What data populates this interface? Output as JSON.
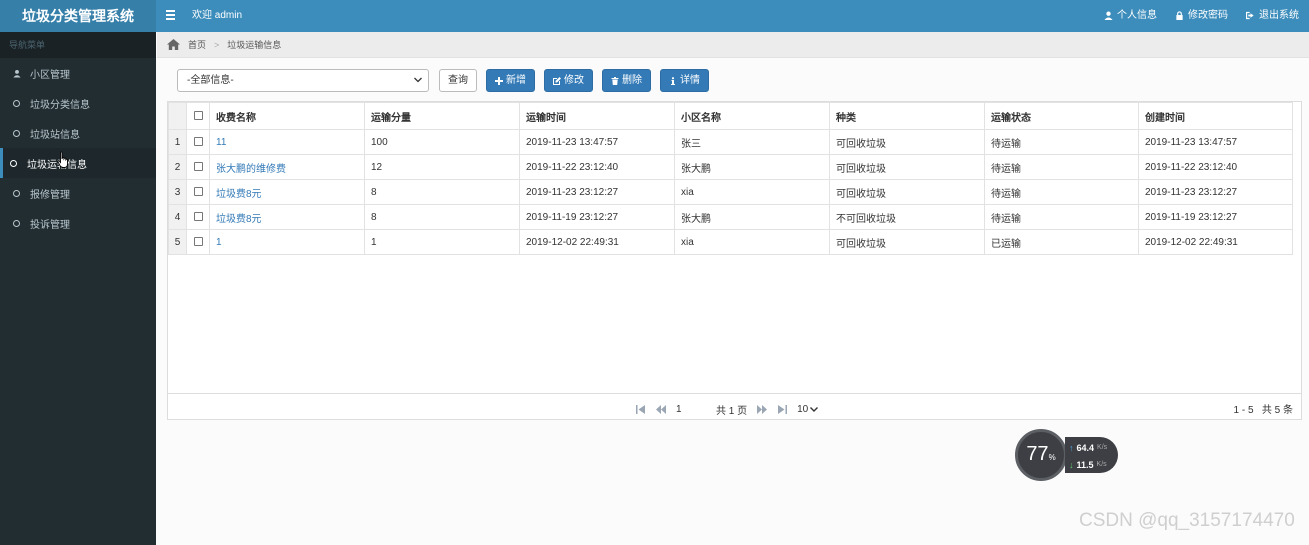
{
  "app": {
    "title": "垃圾分类管理系统",
    "welcome": "欢迎 admin"
  },
  "top_actions": [
    {
      "label": "个人信息",
      "icon": "user-icon"
    },
    {
      "label": "修改密码",
      "icon": "lock-icon"
    },
    {
      "label": "退出系统",
      "icon": "logout-icon"
    }
  ],
  "sidebar": {
    "header": "导航菜单",
    "items": [
      {
        "label": "小区管理",
        "icon": "user-icon"
      },
      {
        "label": "垃圾分类信息",
        "icon": "circle-icon"
      },
      {
        "label": "垃圾站信息",
        "icon": "circle-icon"
      },
      {
        "label": "垃圾运输信息",
        "icon": "circle-icon",
        "active": true
      },
      {
        "label": "报修管理",
        "icon": "circle-icon"
      },
      {
        "label": "投诉管理",
        "icon": "circle-icon"
      }
    ]
  },
  "breadcrumb": {
    "home": "首页",
    "current": "垃圾运输信息"
  },
  "toolbar": {
    "select_value": "-全部信息-",
    "query": "查询",
    "add": "新增",
    "edit": "修改",
    "delete": "删除",
    "detail": "详情"
  },
  "table": {
    "columns": [
      "收费名称",
      "运输分量",
      "运输时间",
      "小区名称",
      "种类",
      "运输状态",
      "创建时间"
    ],
    "rows": [
      {
        "num": "1",
        "name": "11",
        "amount": "100",
        "time": "2019-11-23 13:47:57",
        "community": "张三",
        "kind": "可回收垃圾",
        "status": "待运输",
        "created": "2019-11-23 13:47:57"
      },
      {
        "num": "2",
        "name": "张大鹏的维修费",
        "amount": "12",
        "time": "2019-11-22 23:12:40",
        "community": "张大鹏",
        "kind": "可回收垃圾",
        "status": "待运输",
        "created": "2019-11-22 23:12:40"
      },
      {
        "num": "3",
        "name": "垃圾费8元",
        "amount": "8",
        "time": "2019-11-23 23:12:27",
        "community": "xia",
        "kind": "可回收垃圾",
        "status": "待运输",
        "created": "2019-11-23 23:12:27"
      },
      {
        "num": "4",
        "name": "垃圾费8元",
        "amount": "8",
        "time": "2019-11-19 23:12:27",
        "community": "张大鹏",
        "kind": "不可回收垃圾",
        "status": "待运输",
        "created": "2019-11-19 23:12:27"
      },
      {
        "num": "5",
        "name": "1",
        "amount": "1",
        "time": "2019-12-02 22:49:31",
        "community": "xia",
        "kind": "可回收垃圾",
        "status": "已运输",
        "created": "2019-12-02 22:49:31"
      }
    ]
  },
  "pager": {
    "page": "1",
    "total_pages": "共 1 页",
    "page_size": "10",
    "range": "1 - 5",
    "total": "共 5 条"
  },
  "net_widget": {
    "percent": "77",
    "percent_unit": "%",
    "up": "64.4",
    "down": "11.5",
    "unit": "K/s"
  },
  "watermark": "CSDN @qq_3157174470",
  "colors": {
    "header": "#3c8dbc",
    "brand": "#367fa9",
    "sidebar": "#222d32",
    "primary_button": "#337ab7",
    "link": "#337ab7"
  }
}
